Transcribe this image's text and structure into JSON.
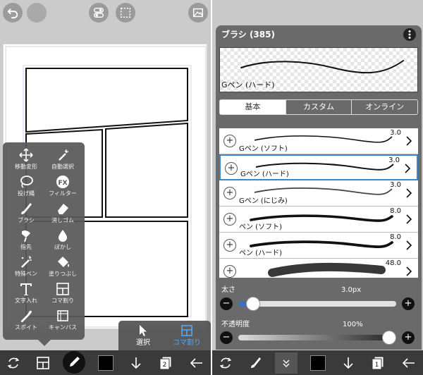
{
  "left": {
    "tool_popup": {
      "tools": [
        {
          "label": "移動変形",
          "icon": "move-icon"
        },
        {
          "label": "自動選択",
          "icon": "magic-wand-icon"
        },
        {
          "label": "投げ縄",
          "icon": "lasso-icon"
        },
        {
          "label": "フィルター",
          "icon": "fx-icon"
        },
        {
          "label": "ブラシ",
          "icon": "brush-icon"
        },
        {
          "label": "消しゴム",
          "icon": "eraser-icon"
        },
        {
          "label": "指先",
          "icon": "smudge-icon"
        },
        {
          "label": "ぼかし",
          "icon": "blur-drop-icon"
        },
        {
          "label": "特殊ペン",
          "icon": "special-pen-icon"
        },
        {
          "label": "塗りつぶし",
          "icon": "bucket-icon"
        },
        {
          "label": "文字入れ",
          "icon": "text-icon"
        },
        {
          "label": "コマ割り",
          "icon": "panel-divide-icon"
        },
        {
          "label": "スポイト",
          "icon": "eyedropper-icon"
        },
        {
          "label": "キャンバス",
          "icon": "canvas-icon"
        }
      ]
    },
    "selection_popup": {
      "select_label": "選択",
      "panel_label": "コマ割り"
    },
    "bottombar": {
      "layer_count": "2"
    }
  },
  "right": {
    "panel_title": "ブラシ (385)",
    "preview_name": "Gペン (ハード)",
    "tabs": [
      "基本",
      "カスタム",
      "オンライン"
    ],
    "active_tab": 0,
    "brushes": [
      {
        "name": "Gペン (ソフト)",
        "size": "3.0"
      },
      {
        "name": "Gペン (ハード)",
        "size": "3.0"
      },
      {
        "name": "Gペン (にじみ)",
        "size": "3.0"
      },
      {
        "name": "ペン (ソフト)",
        "size": "8.0"
      },
      {
        "name": "ペン (ハード)",
        "size": "8.0"
      },
      {
        "name": "",
        "size": "48.0"
      }
    ],
    "selected_brush": 1,
    "size_slider": {
      "label": "太さ",
      "value": "3.0px",
      "fraction": 0.05
    },
    "opacity_slider": {
      "label": "不透明度",
      "value": "100%",
      "fraction": 1.0
    },
    "bottombar": {
      "layer_count": "1"
    }
  }
}
